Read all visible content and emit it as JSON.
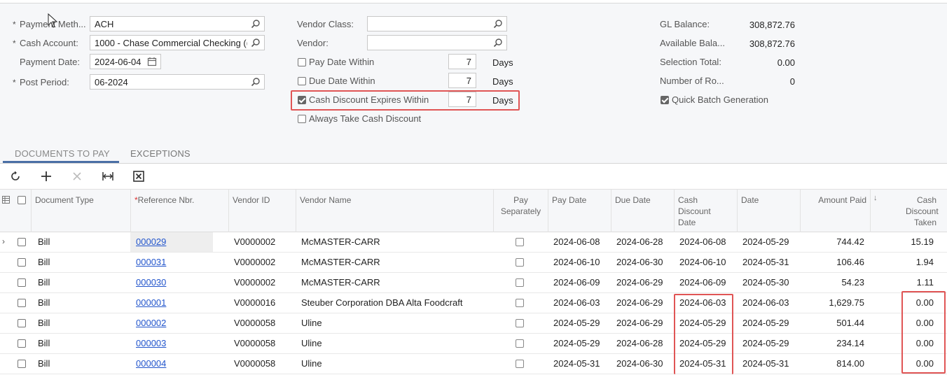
{
  "form": {
    "payment_method": {
      "label": "Payment Meth...",
      "value": "ACH"
    },
    "cash_account": {
      "label": "Cash Account:",
      "value": "1000 - Chase Commercial Checking (("
    },
    "payment_date": {
      "label": "Payment Date:",
      "value": "2024-06-04"
    },
    "post_period": {
      "label": "Post Period:",
      "value": "06-2024"
    },
    "vendor_class": {
      "label": "Vendor Class:",
      "value": ""
    },
    "vendor": {
      "label": "Vendor:",
      "value": ""
    },
    "pay_date_within": {
      "label": "Pay Date Within",
      "checked": false,
      "value": "7",
      "unit": "Days"
    },
    "due_date_within": {
      "label": "Due Date Within",
      "checked": false,
      "value": "7",
      "unit": "Days"
    },
    "cash_discount_expires": {
      "label": "Cash Discount Expires Within",
      "checked": true,
      "value": "7",
      "unit": "Days"
    },
    "always_take_discount": {
      "label": "Always Take Cash Discount",
      "checked": false
    },
    "gl_balance": {
      "label": "GL Balance:",
      "value": "308,872.76"
    },
    "available_balance": {
      "label": "Available Bala...",
      "value": "308,872.76"
    },
    "selection_total": {
      "label": "Selection Total:",
      "value": "0.00"
    },
    "number_of_rows": {
      "label": "Number of Ro...",
      "value": "0"
    },
    "quick_batch": {
      "label": "Quick Batch Generation",
      "checked": true
    }
  },
  "tabs": [
    {
      "label": "DOCUMENTS TO PAY",
      "active": true
    },
    {
      "label": "EXCEPTIONS",
      "active": false
    }
  ],
  "toolbar": {
    "refresh_icon": "refresh-icon",
    "add_icon": "plus-icon",
    "delete_icon": "close-icon",
    "fit_icon": "fit-columns-icon",
    "export_icon": "excel-export-icon"
  },
  "grid": {
    "headers": {
      "document_type": "Document Type",
      "reference_nbr": "Reference Nbr.",
      "vendor_id": "Vendor ID",
      "vendor_name": "Vendor Name",
      "pay_separately": "Pay Separately",
      "pay_date": "Pay Date",
      "due_date": "Due Date",
      "cash_discount_date": "Cash Discount Date",
      "date": "Date",
      "amount_paid": "Amount Paid",
      "cash_discount_taken": "Cash Discount Taken"
    },
    "rows": [
      {
        "type": "Bill",
        "ref": "000029",
        "vendor_id": "V0000002",
        "vendor_name": "McMASTER-CARR",
        "pay_date": "2024-06-08",
        "due_date": "2024-06-28",
        "disc_date": "2024-06-08",
        "date": "2024-05-29",
        "amount": "744.42",
        "disc_taken": "15.19"
      },
      {
        "type": "Bill",
        "ref": "000031",
        "vendor_id": "V0000002",
        "vendor_name": "McMASTER-CARR",
        "pay_date": "2024-06-10",
        "due_date": "2024-06-30",
        "disc_date": "2024-06-10",
        "date": "2024-05-31",
        "amount": "106.46",
        "disc_taken": "1.94"
      },
      {
        "type": "Bill",
        "ref": "000030",
        "vendor_id": "V0000002",
        "vendor_name": "McMASTER-CARR",
        "pay_date": "2024-06-09",
        "due_date": "2024-06-29",
        "disc_date": "2024-06-09",
        "date": "2024-05-30",
        "amount": "54.23",
        "disc_taken": "1.11"
      },
      {
        "type": "Bill",
        "ref": "000001",
        "vendor_id": "V0000016",
        "vendor_name": "Steuber Corporation DBA Alta Foodcraft",
        "pay_date": "2024-06-03",
        "due_date": "2024-06-29",
        "disc_date": "2024-06-03",
        "date": "2024-06-03",
        "amount": "1,629.75",
        "disc_taken": "0.00"
      },
      {
        "type": "Bill",
        "ref": "000002",
        "vendor_id": "V0000058",
        "vendor_name": "Uline",
        "pay_date": "2024-05-29",
        "due_date": "2024-06-29",
        "disc_date": "2024-05-29",
        "date": "2024-05-29",
        "amount": "501.44",
        "disc_taken": "0.00"
      },
      {
        "type": "Bill",
        "ref": "000003",
        "vendor_id": "V0000058",
        "vendor_name": "Uline",
        "pay_date": "2024-05-29",
        "due_date": "2024-06-28",
        "disc_date": "2024-05-29",
        "date": "2024-05-29",
        "amount": "234.14",
        "disc_taken": "0.00"
      },
      {
        "type": "Bill",
        "ref": "000004",
        "vendor_id": "V0000058",
        "vendor_name": "Uline",
        "pay_date": "2024-05-31",
        "due_date": "2024-06-30",
        "disc_date": "2024-05-31",
        "date": "2024-05-31",
        "amount": "814.00",
        "disc_taken": "0.00"
      }
    ]
  },
  "colors": {
    "accent": "#4a6fa5",
    "link": "#2255cc",
    "highlight": "#e05555"
  }
}
